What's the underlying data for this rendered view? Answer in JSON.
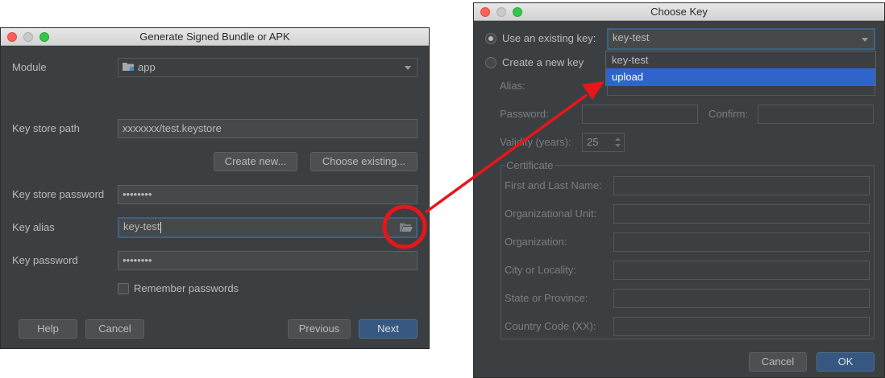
{
  "left_dialog": {
    "title": "Generate Signed Bundle or APK",
    "module_label": "Module",
    "module_value": "app",
    "keystore_path_label": "Key store path",
    "keystore_path_value": "xxxxxxx/test.keystore",
    "create_new_label": "Create new...",
    "choose_existing_label": "Choose existing...",
    "keystore_password_label": "Key store password",
    "keystore_password_value": "••••••••",
    "key_alias_label": "Key alias",
    "key_alias_value": "key-test",
    "key_password_label": "Key password",
    "key_password_value": "••••••••",
    "remember_label": "Remember passwords",
    "remember_checked": false,
    "help_label": "Help",
    "cancel_label": "Cancel",
    "previous_label": "Previous",
    "next_label": "Next"
  },
  "right_dialog": {
    "title": "Choose Key",
    "use_existing_label": "Use an existing key:",
    "use_existing_selected": true,
    "existing_key_value": "key-test",
    "dropdown_options": [
      "key-test",
      "upload"
    ],
    "dropdown_highlighted": "upload",
    "create_new_label": "Create a new key",
    "alias_label": "Alias:",
    "password_label": "Password:",
    "confirm_label": "Confirm:",
    "validity_label": "Validity (years):",
    "validity_value": "25",
    "certificate_label": "Certificate",
    "cert_fields": [
      "First and Last Name:",
      "Organizational Unit:",
      "Organization:",
      "City or Locality:",
      "State or Province:",
      "Country Code (XX):"
    ],
    "cancel_label": "Cancel",
    "ok_label": "OK"
  },
  "annotation": {
    "color": "#e8151b"
  }
}
